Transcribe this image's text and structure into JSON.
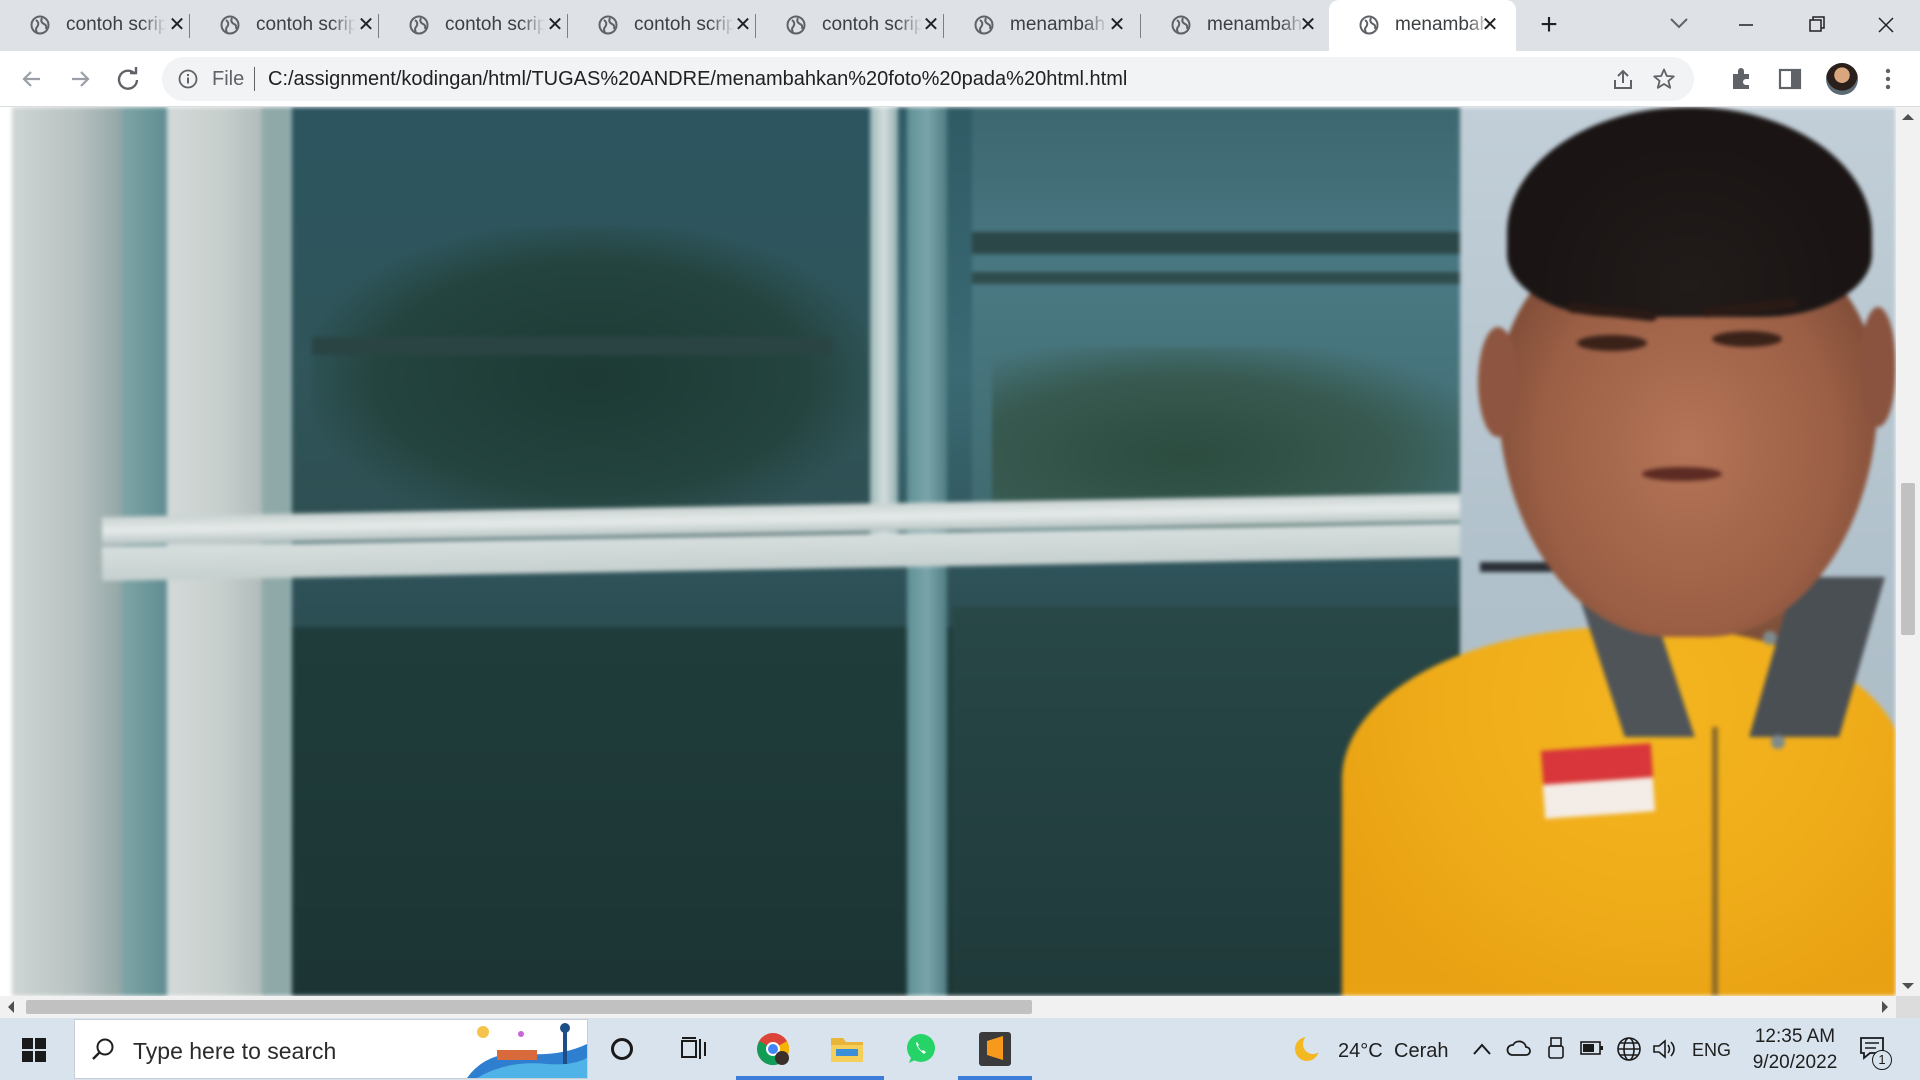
{
  "tabs": [
    {
      "label": "contoh scrip",
      "active": false
    },
    {
      "label": "contoh scrip",
      "active": false
    },
    {
      "label": "contoh scrip",
      "active": false
    },
    {
      "label": "contoh scrip",
      "active": false
    },
    {
      "label": "contoh scrip",
      "active": false
    },
    {
      "label": "menambah",
      "active": false
    },
    {
      "label": "menambah",
      "active": false
    },
    {
      "label": "menambah",
      "active": true
    }
  ],
  "omnibox": {
    "scheme_label": "File",
    "url": "C:/assignment/kodingan/html/TUGAS%20ANDRE/menambahkan%20foto%20pada%20html.html"
  },
  "taskbar": {
    "search_placeholder": "Type here to search",
    "weather_temp": "24°C",
    "weather_desc": "Cerah",
    "language": "ENG",
    "time": "12:35 AM",
    "date": "9/20/2022",
    "notification_count": "1"
  },
  "colors": {
    "accent": "#3b7dd8",
    "tab_strip": "#dee1e6",
    "taskbar": "#d9e3ee"
  }
}
